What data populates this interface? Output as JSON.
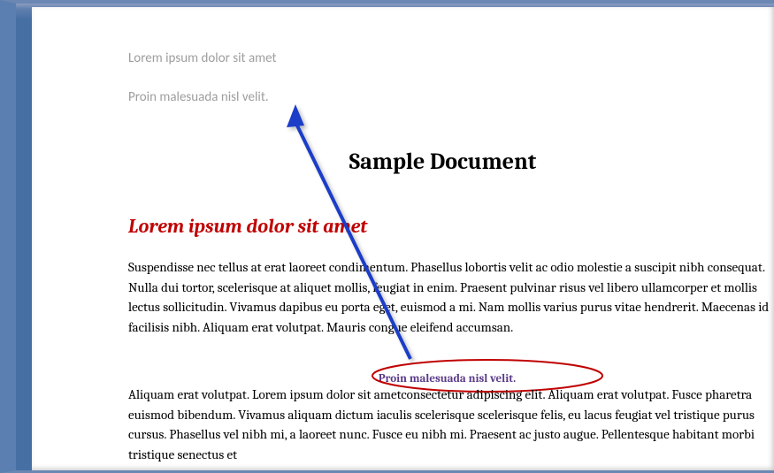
{
  "header": {
    "line1": "Lorem ipsum dolor sit amet",
    "line2": "Proin malesuada nisl velit."
  },
  "title": "Sample Document",
  "heading1": "Lorem ipsum dolor sit amet",
  "paragraph1": "Suspendisse nec tellus at erat laoreet condimentum. Phasellus lobortis velit ac odio molestie a suscipit nibh consequat. Nulla dui tortor, scelerisque at aliquet mollis, feugiat in enim. Praesent  pulvinar risus vel libero ullamcorper et mollis lectus sollicitudin. Vivamus dapibus eu porta eget, euismod a mi. Nam mollis varius purus vitae hendrerit. Maecenas id facilisis nibh. Aliquam erat volutpat. Mauris congue eleifend accumsan.",
  "callout": "Proin malesuada nisl velit.",
  "paragraph2": "Aliquam erat volutpat. Lorem ipsum dolor sit ametconsectetur adipiscing elit.  Aliquam erat volutpat. Fusce pharetra euismod bibendum. Vivamus aliquam dictum iaculis scelerisque scelerisque felis, eu lacus feugiat vel tristique purus cursus. Phasellus vel nibh mi, a laoreet nunc. Fusce eu nibh mi. Praesent ac justo augue. Pellentesque habitant morbi tristique senectus et",
  "colors": {
    "heading": "#c00000",
    "callout_text": "#5a3a88",
    "ellipse_stroke": "#c00000",
    "arrow": "#1a3ec8",
    "header_grey": "#9e9e9e"
  }
}
